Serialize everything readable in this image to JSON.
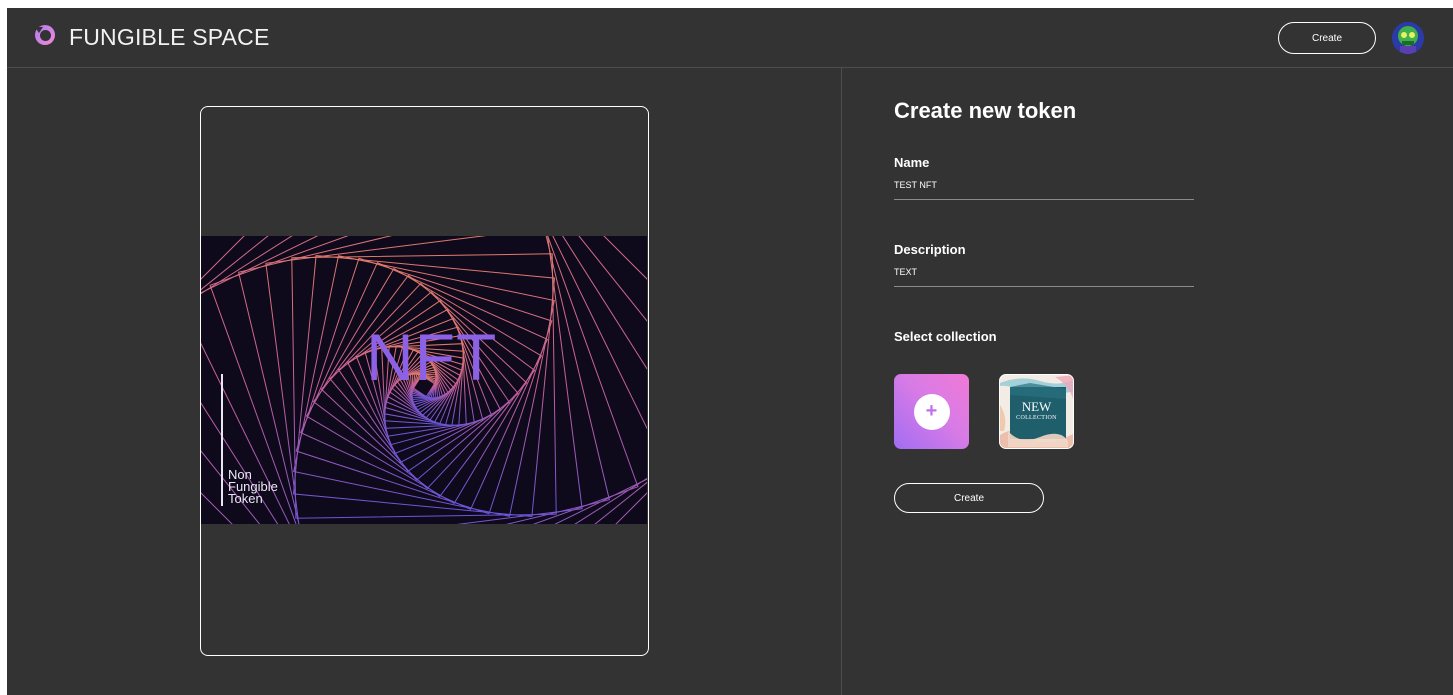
{
  "header": {
    "brand": "FUNGIBLE SPACE",
    "logo_icon": "fungible-space-logo-icon",
    "create_label": "Create",
    "avatar_icon": "user-avatar-icon"
  },
  "preview": {
    "image_title": "NFT",
    "image_subtitle": [
      "Non",
      "Fungible",
      "Token"
    ]
  },
  "form": {
    "title": "Create new token",
    "name_label": "Name",
    "name_value": "TEST NFT",
    "description_label": "Description",
    "description_value": "TEXT",
    "collection_label": "Select collection",
    "add_collection_icon": "plus-icon",
    "collection_tile": {
      "title": "NEW",
      "subtitle": "COLLECTION"
    },
    "create_label": "Create"
  },
  "colors": {
    "background": "#333333",
    "accent_gradient_start": "#a26df2",
    "accent_gradient_end": "#f07ad6",
    "nft_title": "#8c61e6"
  }
}
